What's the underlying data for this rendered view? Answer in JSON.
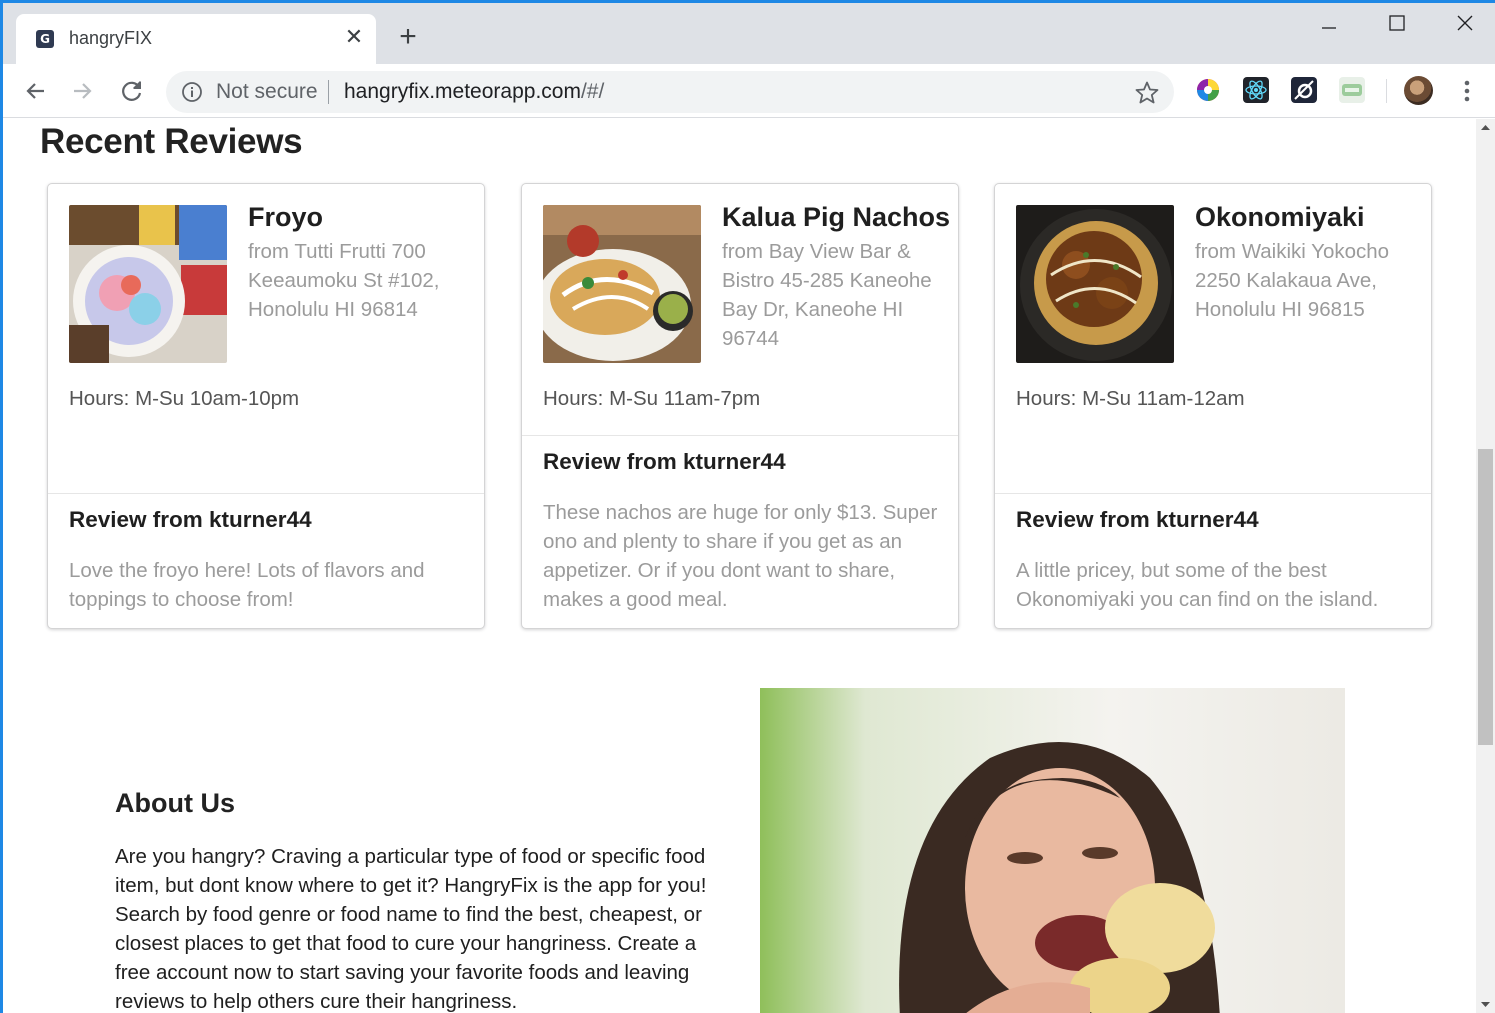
{
  "browser": {
    "tab_title": "hangryFIX",
    "favicon_glyph": "G",
    "close_glyph": "✕",
    "new_tab_glyph": "+",
    "security_label": "Not secure",
    "url_host": "hangryfix.meteorapp.com",
    "url_path": "/#/",
    "icons": [
      "back-arrow-icon",
      "forward-arrow-icon",
      "reload-icon",
      "info-icon",
      "star-icon",
      "color-wheel-icon",
      "react-icon",
      "meteor-icon",
      "sage-icon",
      "kebab-menu-icon"
    ]
  },
  "page": {
    "heading": "Recent Reviews",
    "cards": [
      {
        "name": "Froyo",
        "meta": "from Tutti Frutti 700 Keeaumoku St #102, Honolulu HI 96814",
        "hours": "Hours: M-Su 10am-10pm",
        "review_title": "Review from kturner44",
        "review_text": "Love the froyo here! Lots of flavors and toppings to choose from!"
      },
      {
        "name": "Kalua Pig Nachos",
        "meta": "from Bay View Bar & Bistro 45-285 Kaneohe Bay Dr, Kaneohe HI 96744",
        "hours": "Hours: M-Su 11am-7pm",
        "review_title": "Review from kturner44",
        "review_text": "These nachos are huge for only $13. Super ono and plenty to share if you get as an appetizer. Or if you dont want to share, makes a good meal."
      },
      {
        "name": "Okonomiyaki",
        "meta": "from Waikiki Yokocho 2250 Kalakaua Ave, Honolulu HI 96815",
        "hours": "Hours: M-Su 11am-12am",
        "review_title": "Review from kturner44",
        "review_text": "A little pricey, but some of the best Okonomiyaki you can find on the island."
      }
    ],
    "about": {
      "title": "About Us",
      "text": "Are you hangry? Craving a particular type of food or specific food item, but dont know where to get it? HangryFix is the app for you! Search by food genre or food name to find the best, cheapest, or closest places to get that food to cure your hangriness. Create a free account now to start saving your favorite foods and leaving reviews to help others cure their hangriness."
    }
  },
  "colors": {
    "chrome_accent": "#1e88e5",
    "tabstrip": "#dee1e6",
    "muted_text": "#9b9b9b"
  }
}
